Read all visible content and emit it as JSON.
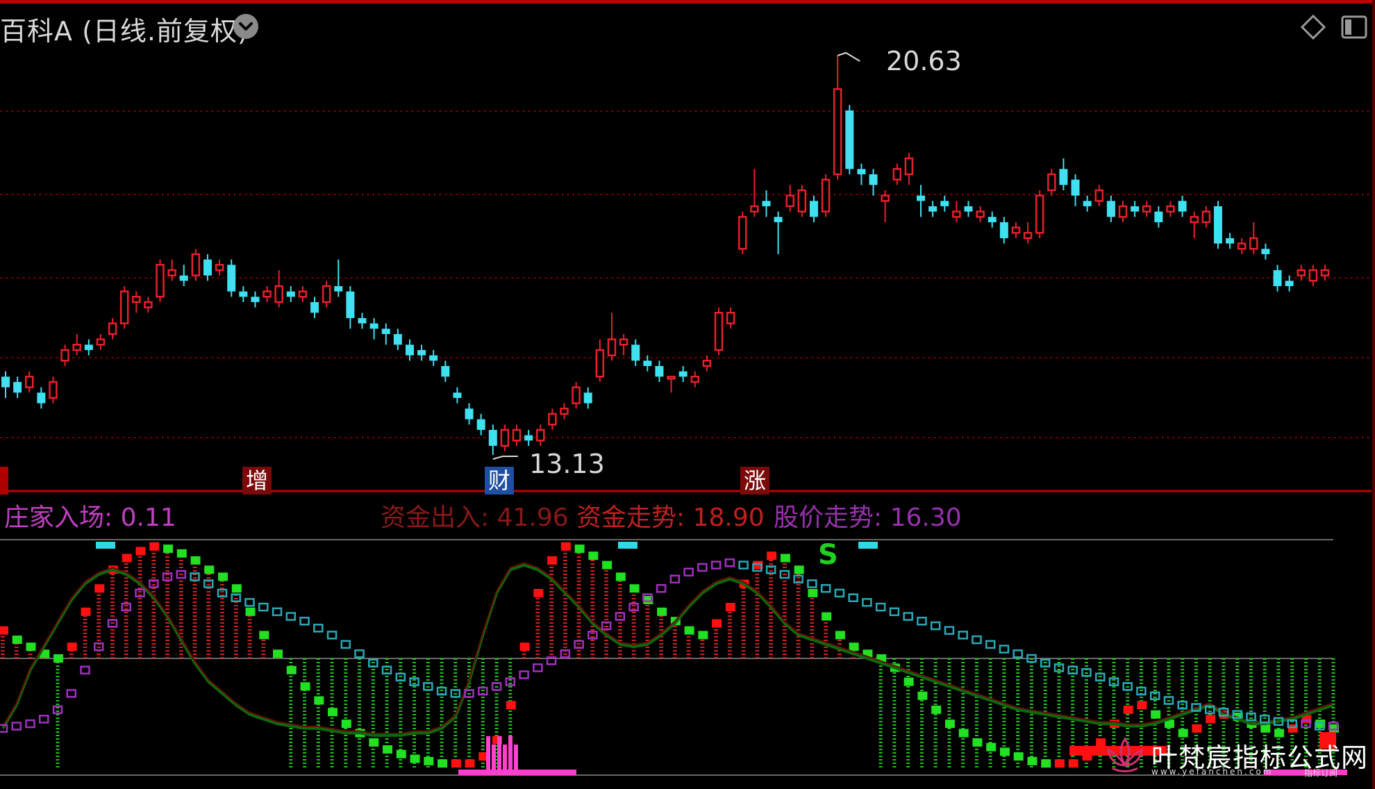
{
  "header": {
    "title": "百科A (日线.前复权)"
  },
  "annotations": {
    "high_price": "20.63",
    "low_price": "13.13"
  },
  "badges": {
    "zeng": "增",
    "cai": "财",
    "zhang": "涨"
  },
  "indicator": {
    "zhuangjia_label": "庄家入场: 0.11",
    "zijin_churu_label": "资金出入: 41.96",
    "zijin_zoushi_label": "资金走势: 18.90",
    "gujia_zoushi_label": "股价走势: 16.30",
    "signal_s": "S"
  },
  "watermark": {
    "title": "叶梵宸指标公式网",
    "url": "www.yefanchen.com",
    "sub": "指标订阅"
  },
  "colors": {
    "up": "#e8202a",
    "down": "#3fe0f0",
    "grid": "#8b0000",
    "zhuangjia": "#c040c0",
    "zijin_churu": "#c02020",
    "zijin_zoushi": "#c02020",
    "gujia_zoushi": "#9a30b0",
    "fund_green": "#20e020",
    "dark_green": "#0a6a0a"
  },
  "chart_data": [
    {
      "type": "candlestick",
      "title": "",
      "high": 20.63,
      "low": 13.13,
      "candles": [
        {
          "o": 14.6,
          "c": 14.4,
          "h": 14.7,
          "l": 14.2
        },
        {
          "o": 14.5,
          "c": 14.3,
          "h": 14.6,
          "l": 14.2
        },
        {
          "o": 14.4,
          "c": 14.6,
          "h": 14.7,
          "l": 14.3
        },
        {
          "o": 14.3,
          "c": 14.1,
          "h": 14.4,
          "l": 14.0
        },
        {
          "o": 14.2,
          "c": 14.5,
          "h": 14.6,
          "l": 14.1
        },
        {
          "o": 14.9,
          "c": 15.1,
          "h": 15.2,
          "l": 14.8
        },
        {
          "o": 15.1,
          "c": 15.2,
          "h": 15.4,
          "l": 15.0
        },
        {
          "o": 15.2,
          "c": 15.1,
          "h": 15.3,
          "l": 15.0
        },
        {
          "o": 15.2,
          "c": 15.3,
          "h": 15.4,
          "l": 15.1
        },
        {
          "o": 15.4,
          "c": 15.6,
          "h": 15.7,
          "l": 15.3
        },
        {
          "o": 15.6,
          "c": 16.2,
          "h": 16.3,
          "l": 15.5
        },
        {
          "o": 16.0,
          "c": 16.1,
          "h": 16.2,
          "l": 15.8
        },
        {
          "o": 15.9,
          "c": 16.0,
          "h": 16.1,
          "l": 15.8
        },
        {
          "o": 16.1,
          "c": 16.7,
          "h": 16.8,
          "l": 16.0
        },
        {
          "o": 16.5,
          "c": 16.6,
          "h": 16.8,
          "l": 16.4
        },
        {
          "o": 16.5,
          "c": 16.4,
          "h": 16.7,
          "l": 16.3
        },
        {
          "o": 16.5,
          "c": 16.9,
          "h": 17.0,
          "l": 16.4
        },
        {
          "o": 16.8,
          "c": 16.5,
          "h": 16.9,
          "l": 16.4
        },
        {
          "o": 16.6,
          "c": 16.7,
          "h": 16.8,
          "l": 16.5
        },
        {
          "o": 16.7,
          "c": 16.2,
          "h": 16.8,
          "l": 16.1
        },
        {
          "o": 16.2,
          "c": 16.1,
          "h": 16.3,
          "l": 16.0
        },
        {
          "o": 16.1,
          "c": 16.0,
          "h": 16.2,
          "l": 15.9
        },
        {
          "o": 16.1,
          "c": 16.2,
          "h": 16.3,
          "l": 16.0
        },
        {
          "o": 16.0,
          "c": 16.3,
          "h": 16.6,
          "l": 15.9
        },
        {
          "o": 16.2,
          "c": 16.1,
          "h": 16.3,
          "l": 16.0
        },
        {
          "o": 16.1,
          "c": 16.2,
          "h": 16.3,
          "l": 16.0
        },
        {
          "o": 16.0,
          "c": 15.8,
          "h": 16.1,
          "l": 15.7
        },
        {
          "o": 16.0,
          "c": 16.3,
          "h": 16.4,
          "l": 15.9
        },
        {
          "o": 16.3,
          "c": 16.2,
          "h": 16.8,
          "l": 16.1
        },
        {
          "o": 16.2,
          "c": 15.7,
          "h": 16.3,
          "l": 15.5
        },
        {
          "o": 15.7,
          "c": 15.6,
          "h": 15.8,
          "l": 15.5
        },
        {
          "o": 15.6,
          "c": 15.5,
          "h": 15.7,
          "l": 15.3
        },
        {
          "o": 15.5,
          "c": 15.4,
          "h": 15.6,
          "l": 15.2
        },
        {
          "o": 15.4,
          "c": 15.2,
          "h": 15.5,
          "l": 15.1
        },
        {
          "o": 15.2,
          "c": 15.0,
          "h": 15.3,
          "l": 14.9
        },
        {
          "o": 15.1,
          "c": 15.0,
          "h": 15.2,
          "l": 14.9
        },
        {
          "o": 15.0,
          "c": 14.9,
          "h": 15.1,
          "l": 14.8
        },
        {
          "o": 14.8,
          "c": 14.6,
          "h": 14.9,
          "l": 14.5
        },
        {
          "o": 14.3,
          "c": 14.2,
          "h": 14.4,
          "l": 14.1
        },
        {
          "o": 14.0,
          "c": 13.8,
          "h": 14.1,
          "l": 13.7
        },
        {
          "o": 13.8,
          "c": 13.6,
          "h": 13.9,
          "l": 13.5
        },
        {
          "o": 13.6,
          "c": 13.3,
          "h": 13.7,
          "l": 13.13
        },
        {
          "o": 13.3,
          "c": 13.6,
          "h": 13.7,
          "l": 13.2
        },
        {
          "o": 13.4,
          "c": 13.6,
          "h": 13.7,
          "l": 13.3
        },
        {
          "o": 13.5,
          "c": 13.4,
          "h": 13.6,
          "l": 13.3
        },
        {
          "o": 13.4,
          "c": 13.6,
          "h": 13.7,
          "l": 13.3
        },
        {
          "o": 13.7,
          "c": 13.9,
          "h": 14.0,
          "l": 13.6
        },
        {
          "o": 13.9,
          "c": 14.0,
          "h": 14.1,
          "l": 13.8
        },
        {
          "o": 14.1,
          "c": 14.4,
          "h": 14.5,
          "l": 14.0
        },
        {
          "o": 14.3,
          "c": 14.1,
          "h": 14.4,
          "l": 14.0
        },
        {
          "o": 14.6,
          "c": 15.1,
          "h": 15.3,
          "l": 14.5
        },
        {
          "o": 15.0,
          "c": 15.3,
          "h": 15.8,
          "l": 14.9
        },
        {
          "o": 15.2,
          "c": 15.3,
          "h": 15.4,
          "l": 15.0
        },
        {
          "o": 15.2,
          "c": 14.9,
          "h": 15.3,
          "l": 14.8
        },
        {
          "o": 14.9,
          "c": 14.8,
          "h": 15.0,
          "l": 14.7
        },
        {
          "o": 14.8,
          "c": 14.6,
          "h": 14.9,
          "l": 14.5
        },
        {
          "o": 14.6,
          "c": 14.6,
          "h": 14.6,
          "l": 14.3
        },
        {
          "o": 14.7,
          "c": 14.6,
          "h": 14.8,
          "l": 14.5
        },
        {
          "o": 14.5,
          "c": 14.6,
          "h": 14.7,
          "l": 14.4
        },
        {
          "o": 14.8,
          "c": 14.9,
          "h": 15.0,
          "l": 14.7
        },
        {
          "o": 15.1,
          "c": 15.8,
          "h": 15.9,
          "l": 15.0
        },
        {
          "o": 15.6,
          "c": 15.8,
          "h": 15.9,
          "l": 15.5
        },
        {
          "o": 17.0,
          "c": 17.6,
          "h": 17.7,
          "l": 16.9
        },
        {
          "o": 17.7,
          "c": 17.8,
          "h": 18.5,
          "l": 17.6
        },
        {
          "o": 17.9,
          "c": 17.8,
          "h": 18.1,
          "l": 17.6
        },
        {
          "o": 17.6,
          "c": 17.5,
          "h": 17.7,
          "l": 16.9
        },
        {
          "o": 17.8,
          "c": 18.0,
          "h": 18.2,
          "l": 17.7
        },
        {
          "o": 17.7,
          "c": 18.1,
          "h": 18.2,
          "l": 17.6
        },
        {
          "o": 17.9,
          "c": 17.6,
          "h": 18.0,
          "l": 17.5
        },
        {
          "o": 17.7,
          "c": 18.3,
          "h": 18.4,
          "l": 17.6
        },
        {
          "o": 18.4,
          "c": 20.0,
          "h": 20.63,
          "l": 18.3
        },
        {
          "o": 19.6,
          "c": 18.5,
          "h": 19.7,
          "l": 18.4
        },
        {
          "o": 18.5,
          "c": 18.4,
          "h": 18.6,
          "l": 18.2
        },
        {
          "o": 18.4,
          "c": 18.2,
          "h": 18.5,
          "l": 18.0
        },
        {
          "o": 17.9,
          "c": 18.0,
          "h": 18.1,
          "l": 17.5
        },
        {
          "o": 18.3,
          "c": 18.5,
          "h": 18.6,
          "l": 18.2
        },
        {
          "o": 18.4,
          "c": 18.7,
          "h": 18.8,
          "l": 18.2
        },
        {
          "o": 18.0,
          "c": 17.9,
          "h": 18.2,
          "l": 17.6
        },
        {
          "o": 17.8,
          "c": 17.7,
          "h": 17.9,
          "l": 17.6
        },
        {
          "o": 17.9,
          "c": 17.8,
          "h": 18.0,
          "l": 17.7
        },
        {
          "o": 17.6,
          "c": 17.7,
          "h": 17.9,
          "l": 17.5
        },
        {
          "o": 17.8,
          "c": 17.7,
          "h": 17.9,
          "l": 17.6
        },
        {
          "o": 17.6,
          "c": 17.7,
          "h": 17.8,
          "l": 17.5
        },
        {
          "o": 17.6,
          "c": 17.5,
          "h": 17.7,
          "l": 17.4
        },
        {
          "o": 17.5,
          "c": 17.2,
          "h": 17.6,
          "l": 17.1
        },
        {
          "o": 17.3,
          "c": 17.4,
          "h": 17.5,
          "l": 17.2
        },
        {
          "o": 17.2,
          "c": 17.3,
          "h": 17.5,
          "l": 17.1
        },
        {
          "o": 17.3,
          "c": 18.0,
          "h": 18.1,
          "l": 17.2
        },
        {
          "o": 18.1,
          "c": 18.4,
          "h": 18.5,
          "l": 18.0
        },
        {
          "o": 18.5,
          "c": 18.2,
          "h": 18.7,
          "l": 18.1
        },
        {
          "o": 18.3,
          "c": 18.0,
          "h": 18.4,
          "l": 17.8
        },
        {
          "o": 17.9,
          "c": 17.8,
          "h": 18.0,
          "l": 17.7
        },
        {
          "o": 17.9,
          "c": 18.1,
          "h": 18.2,
          "l": 17.8
        },
        {
          "o": 17.9,
          "c": 17.6,
          "h": 18.0,
          "l": 17.5
        },
        {
          "o": 17.6,
          "c": 17.8,
          "h": 17.9,
          "l": 17.5
        },
        {
          "o": 17.8,
          "c": 17.7,
          "h": 17.9,
          "l": 17.6
        },
        {
          "o": 17.7,
          "c": 17.8,
          "h": 17.9,
          "l": 17.6
        },
        {
          "o": 17.7,
          "c": 17.5,
          "h": 17.8,
          "l": 17.4
        },
        {
          "o": 17.7,
          "c": 17.8,
          "h": 17.9,
          "l": 17.6
        },
        {
          "o": 17.9,
          "c": 17.7,
          "h": 18.0,
          "l": 17.6
        },
        {
          "o": 17.5,
          "c": 17.6,
          "h": 17.7,
          "l": 17.2
        },
        {
          "o": 17.5,
          "c": 17.7,
          "h": 17.8,
          "l": 17.4
        },
        {
          "o": 17.8,
          "c": 17.1,
          "h": 17.9,
          "l": 17.0
        },
        {
          "o": 17.2,
          "c": 17.1,
          "h": 17.3,
          "l": 17.0
        },
        {
          "o": 17.0,
          "c": 17.1,
          "h": 17.2,
          "l": 16.9
        },
        {
          "o": 17.0,
          "c": 17.2,
          "h": 17.5,
          "l": 16.9
        },
        {
          "o": 17.0,
          "c": 16.9,
          "h": 17.1,
          "l": 16.8
        },
        {
          "o": 16.6,
          "c": 16.3,
          "h": 16.7,
          "l": 16.2
        },
        {
          "o": 16.4,
          "c": 16.3,
          "h": 16.5,
          "l": 16.2
        },
        {
          "o": 16.5,
          "c": 16.6,
          "h": 16.7,
          "l": 16.4
        },
        {
          "o": 16.4,
          "c": 16.6,
          "h": 16.7,
          "l": 16.3
        },
        {
          "o": 16.5,
          "c": 16.6,
          "h": 16.7,
          "l": 16.4
        }
      ]
    },
    {
      "type": "line",
      "title": "",
      "ylim": [
        0,
        100
      ],
      "series": [
        {
          "name": "资金走势",
          "values": [
            62,
            58,
            55,
            52,
            50,
            55,
            70,
            80,
            88,
            93,
            96,
            98,
            97,
            95,
            92,
            88,
            85,
            80,
            70,
            60,
            52,
            45,
            38,
            32,
            27,
            22,
            18,
            14,
            11,
            9,
            7,
            6,
            5,
            5,
            5,
            8,
            15,
            30,
            55,
            78,
            92,
            98,
            97,
            94,
            90,
            85,
            80,
            75,
            70,
            66,
            62,
            60,
            65,
            72,
            82,
            90,
            94,
            93,
            88,
            78,
            68,
            60,
            55,
            52,
            50,
            46,
            40,
            34,
            28,
            22,
            18,
            14,
            12,
            10,
            8,
            6,
            5,
            5,
            5,
            8,
            14,
            22,
            28,
            30,
            26,
            22,
            18,
            20,
            24,
            26,
            25,
            22,
            20,
            18,
            20,
            24,
            22,
            20
          ]
        },
        {
          "name": "股价走势",
          "values": [
            20,
            21,
            22,
            24,
            28,
            35,
            45,
            55,
            65,
            72,
            78,
            82,
            85,
            86,
            85,
            82,
            78,
            76,
            74,
            72,
            70,
            68,
            66,
            63,
            60,
            56,
            52,
            48,
            45,
            42,
            40,
            38,
            36,
            35,
            35,
            36,
            38,
            40,
            43,
            46,
            49,
            52,
            56,
            60,
            64,
            68,
            72,
            76,
            80,
            84,
            87,
            89,
            90,
            91,
            90,
            89,
            88,
            86,
            84,
            82,
            80,
            78,
            76,
            74,
            72,
            70,
            68,
            66,
            64,
            62,
            60,
            58,
            56,
            54,
            52,
            50,
            48,
            46,
            45,
            44,
            42,
            40,
            38,
            36,
            34,
            32,
            30,
            29,
            28,
            27,
            26,
            25,
            24,
            23,
            22,
            22,
            21,
            21
          ]
        },
        {
          "name": "资金出入",
          "values": [
            20,
            30,
            45,
            55,
            65,
            75,
            82,
            86,
            88,
            86,
            82,
            76,
            68,
            58,
            48,
            40,
            35,
            30,
            26,
            24,
            22,
            21,
            20,
            20,
            19,
            18,
            18,
            17,
            17,
            17,
            18,
            18,
            20,
            25,
            40,
            60,
            78,
            88,
            90,
            88,
            84,
            78,
            72,
            65,
            60,
            56,
            55,
            56,
            60,
            65,
            72,
            78,
            82,
            84,
            82,
            78,
            72,
            65,
            60,
            58,
            56,
            54,
            52,
            50,
            48,
            46,
            44,
            42,
            40,
            38,
            36,
            34,
            32,
            30,
            28,
            27,
            26,
            25,
            24,
            23,
            22,
            22,
            21,
            21,
            22,
            24,
            26,
            28,
            30,
            26,
            24,
            22,
            22,
            23,
            24,
            26,
            28,
            30
          ]
        }
      ]
    }
  ]
}
